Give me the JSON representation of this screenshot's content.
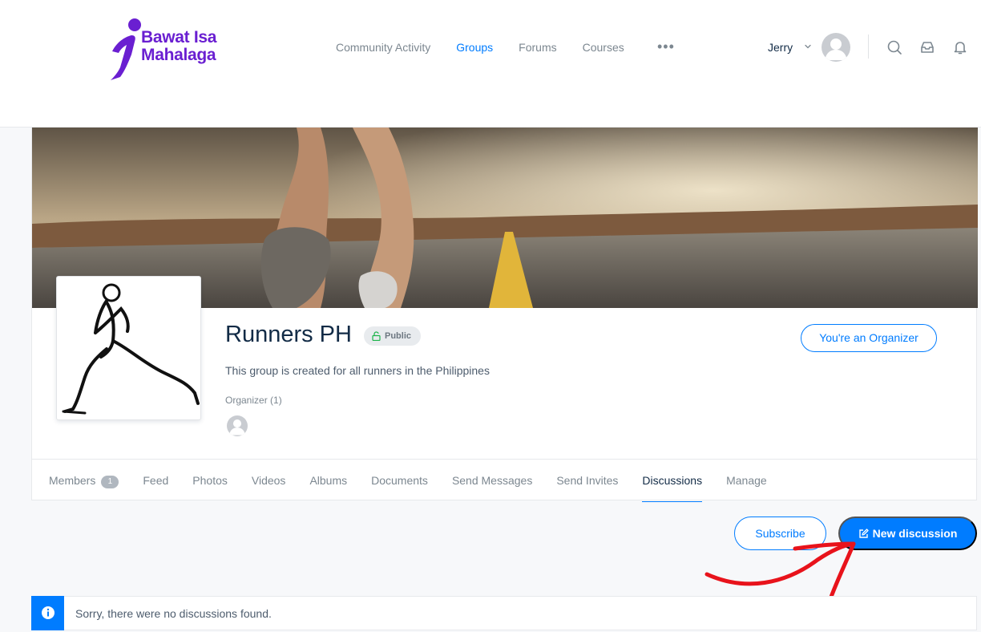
{
  "brand": {
    "logo_line1": "Bawat Isa",
    "logo_line2": "Mahalaga",
    "color": "#6a1fd1"
  },
  "nav": {
    "items": [
      {
        "label": "Community Activity",
        "active": false
      },
      {
        "label": "Groups",
        "active": true
      },
      {
        "label": "Forums",
        "active": false
      },
      {
        "label": "Courses",
        "active": false
      }
    ],
    "more_label": "•••"
  },
  "user": {
    "name": "Jerry"
  },
  "header_icons": [
    "search-icon",
    "inbox-icon",
    "bell-icon"
  ],
  "group": {
    "title": "Runners PH",
    "privacy": "Public",
    "description": "This group is created for all runners in the Philippines",
    "organizer_label": "Organizer (1)",
    "role_button": "You're an Organizer"
  },
  "tabs": [
    {
      "label": "Members",
      "count": "1"
    },
    {
      "label": "Feed"
    },
    {
      "label": "Photos"
    },
    {
      "label": "Videos"
    },
    {
      "label": "Albums"
    },
    {
      "label": "Documents"
    },
    {
      "label": "Send Messages"
    },
    {
      "label": "Send Invites"
    },
    {
      "label": "Discussions",
      "active": true
    },
    {
      "label": "Manage"
    }
  ],
  "actions": {
    "subscribe": "Subscribe",
    "new_discussion": "New discussion"
  },
  "notice": {
    "text": "Sorry, there were no discussions found."
  },
  "colors": {
    "accent": "#007cff",
    "text": "#122b46",
    "annotation": "#e8131b"
  }
}
